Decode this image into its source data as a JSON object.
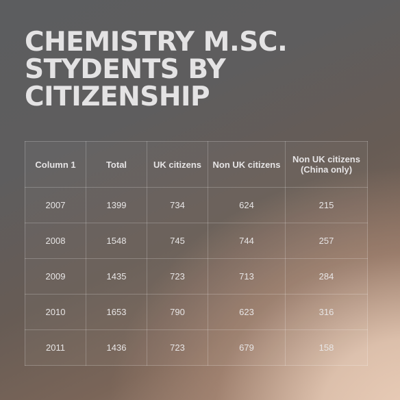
{
  "title": "CHEMISTRY M.SC. STYDENTS BY CITIZENSHIP",
  "colors": {
    "title_text": "#e4e3e4",
    "cell_text": "#e8e6e6",
    "grid_line": "rgba(255,255,255,0.22)"
  },
  "chart_data": {
    "type": "table",
    "title": "CHEMISTRY M.SC. STYDENTS BY CITIZENSHIP",
    "columns": [
      "Column 1",
      "Total",
      "UK citizens",
      "Non UK citizens",
      "Non UK citizens (China only)"
    ],
    "rows": [
      [
        "2007",
        "1399",
        "734",
        "624",
        "215"
      ],
      [
        "2008",
        "1548",
        "745",
        "744",
        "257"
      ],
      [
        "2009",
        "1435",
        "723",
        "713",
        "284"
      ],
      [
        "2010",
        "1653",
        "790",
        "623",
        "316"
      ],
      [
        "2011",
        "1436",
        "723",
        "679",
        "158"
      ]
    ]
  }
}
